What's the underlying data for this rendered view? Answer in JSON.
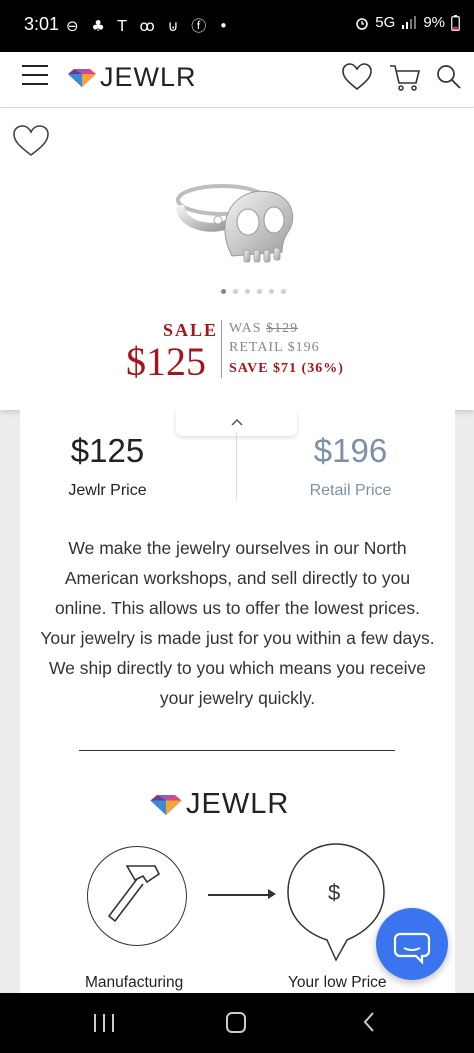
{
  "status_bar": {
    "time": "3:01",
    "left_icons": "⊖ ♣ T ꝏ ⊍ ⓕ •",
    "network": "5G",
    "battery": "9%"
  },
  "header": {
    "logo_text": "JEWLR",
    "icons": [
      "menu-icon",
      "heart-icon",
      "cart-icon",
      "search-icon"
    ]
  },
  "product": {
    "sale_label": "SALE",
    "sale_price": "$125",
    "was_label": "WAS",
    "was_price": "$129",
    "retail_line": "RETAIL $196",
    "save_line": "SAVE $71 (36%)",
    "image_count": 6,
    "active_image": 1
  },
  "comparison": {
    "jewlr_price": "$125",
    "jewlr_label": "Jewlr Price",
    "retail_price": "$196",
    "retail_label": "Retail Price",
    "description": "We make the jewelry ourselves in our North American workshops, and sell directly to you online. This allows us to offer the lowest prices. Your jewelry is made just for you within a few days. We ship directly to you which means you receive your jewelry quickly.",
    "logo_text": "JEWLR",
    "steps": [
      {
        "label": "Manufacturing",
        "icon": "hammer-icon"
      },
      {
        "label": "Your low Price",
        "icon": "dollar-icon",
        "symbol": "$"
      }
    ]
  },
  "colors": {
    "sale_red": "#a8141b",
    "retail_blue_gray": "#7e90a6",
    "chat_blue": "#3a74ee"
  }
}
